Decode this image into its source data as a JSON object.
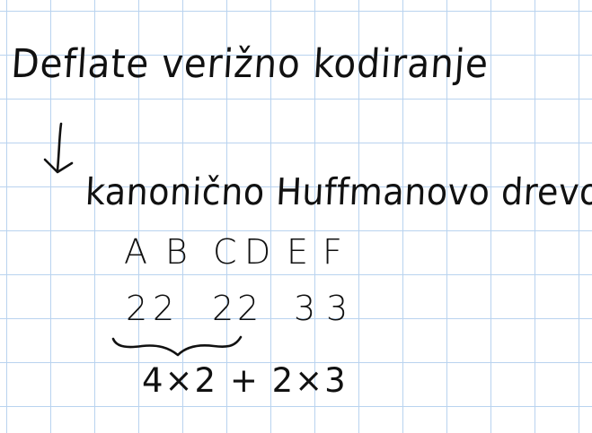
{
  "note": {
    "title": "Deflate verižno kodiranje",
    "subtitle": "kanonično Huffmanovo drevo",
    "symbols": [
      "A",
      "B",
      "C",
      "D",
      "E",
      "F"
    ],
    "code_lengths": [
      "2",
      "2",
      "2",
      "2",
      "3",
      "3"
    ],
    "sum_terms": "4×2  + 2×3"
  },
  "colors": {
    "ink": "#111111",
    "grid": "#b9d3ef",
    "paper": "#ffffff"
  }
}
